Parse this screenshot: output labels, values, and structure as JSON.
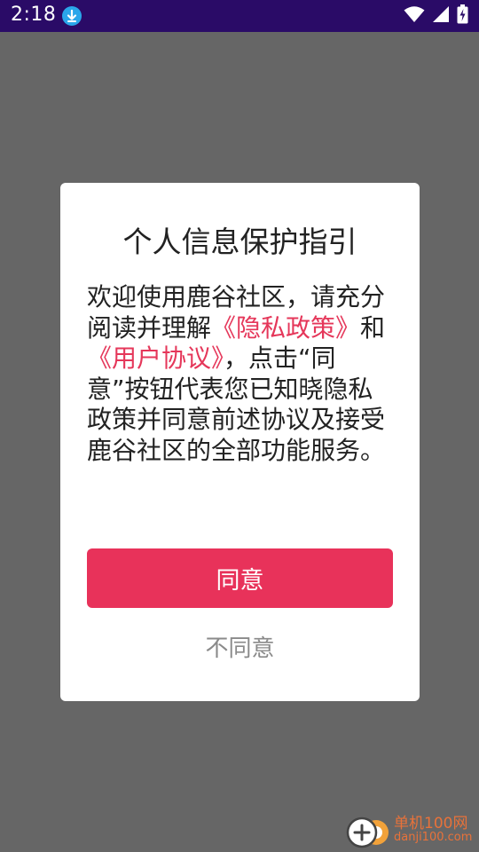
{
  "status_bar": {
    "time": "2:18",
    "icons": [
      "download-icon",
      "wifi-icon",
      "signal-icon",
      "battery-charging-icon"
    ],
    "background": "#2a0b67"
  },
  "dialog": {
    "title": "个人信息保护指引",
    "body": {
      "text_1": "欢迎使用鹿谷社区，请充分阅读并理解",
      "privacy_link": "《隐私政策》",
      "text_2": "和",
      "agreement_link": "《用户协议》",
      "text_3": "，点击“同意”按钮代表您已知晓隐私政策并同意前述协议及接受鹿谷社区的全部功能服务。"
    },
    "agree_label": "同意",
    "disagree_label": "不同意",
    "accent_color": "#e8325a"
  },
  "watermark": {
    "name": "单机100网",
    "url": "danji100.com"
  }
}
